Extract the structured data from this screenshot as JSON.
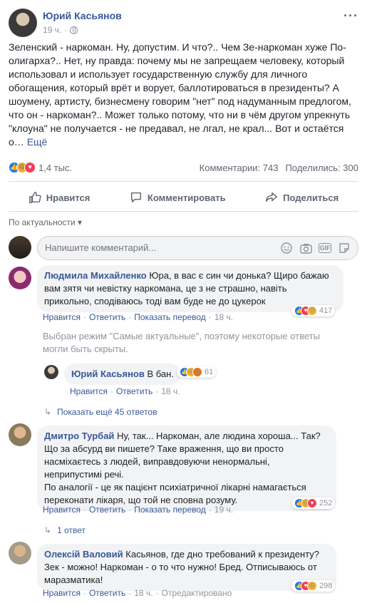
{
  "post": {
    "author": "Юрий Касьянов",
    "time": "19 ч.",
    "menu": "···",
    "text": "Зеленский - наркоман. Ну, допустим. И что?.. Чем Зе-наркоман хуже По-олигарха?.. Нет, ну правда: почему мы не запрещаем человеку, который использовал и использует государственную службу для личного обогащения, который врёт и ворует, баллотироваться в президенты? А шоумену, артисту, бизнесмену говорим \"нет\" под надуманным предлогом, что он - наркоман?.. Может только потому, что ни в чём другом упрекнуть \"клоуна\" не получается - не предавал, не лгал, не крал... Вот и остаётся о…",
    "more": "Ещё",
    "reactions_count": "1,4 тыс.",
    "comments_count": "Комментарии: 743",
    "shares_count": "Поделились: 300"
  },
  "actions": {
    "like": "Нравится",
    "comment": "Комментировать",
    "share": "Поделиться"
  },
  "sort": "По актуальности ▾",
  "comment_input": {
    "placeholder": "Напишите комментарий...",
    "gif": "GIF"
  },
  "comments": [
    {
      "name": "Людмила Михайленко",
      "text": "Юра, в вас є син чи донька? Щиро бажаю вам зятя чи невістку наркомана, це з не страшно, навіть прикольно, сподіваюсь тоді вам буде не до цукерок",
      "like": "Нравится",
      "reply": "Ответить",
      "translate": "Показать перевод",
      "time": "18 ч.",
      "reactions": "417"
    },
    {
      "name": "Дмитро Турбай",
      "text_lines": [
        "Ну, так... Наркоман, але людина хороша... Так?",
        "Що за абсурд ви пишете? Таке враження, що ви просто насміхаєтесь з людей, виправдовуючи ненормальні, неприпустимі речі.",
        "По аналогії - це як пацієнт психіатричної лікарні намагається переконати лікаря, що той не сповна розуму."
      ],
      "like": "Нравится",
      "reply": "Ответить",
      "translate": "Показать перевод",
      "time": "19 ч.",
      "reactions": "252"
    },
    {
      "name": "Олексій Валовий",
      "text": "Касьянов, где дно требований к президенту? Зек - можно! Наркоман - о то что нужно! Бред. Отписываюсь от маразматика!",
      "like": "Нравится",
      "reply": "Ответить",
      "time": "18 ч.",
      "edited": "Отредактировано",
      "reactions": "298"
    }
  ],
  "mode_note": "Выбран режим \"Самые актуальные\", поэтому некоторые ответы могли быть скрыты.",
  "reply": {
    "name": "Юрий Касьянов",
    "text": "В бан.",
    "like": "Нравится",
    "reply": "Ответить",
    "time": "18 ч.",
    "reactions": "61"
  },
  "more_replies": "Показать ещё 45 ответов",
  "one_reply": "1 ответ",
  "sep": "·"
}
